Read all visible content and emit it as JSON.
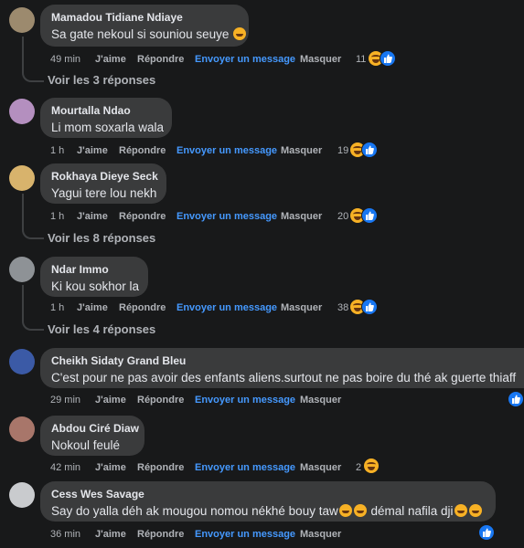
{
  "actions": {
    "like": "J'aime",
    "reply": "Répondre",
    "message": "Envoyer un message",
    "hide": "Masquer"
  },
  "comments": [
    {
      "author": "Mamadou Tidiane Ndiaye",
      "text": "Sa gate nekoul si souniou seuye",
      "time": "49 min",
      "reactions": "11",
      "replies": "Voir les 3 réponses"
    },
    {
      "author": "Mourtalla Ndao",
      "text": "Li mom soxarla wala",
      "time": "1 h",
      "reactions": "19"
    },
    {
      "author": "Rokhaya Dieye Seck",
      "text": "Yagui tere lou nekh",
      "time": "1 h",
      "reactions": "20",
      "replies": "Voir les 8 réponses"
    },
    {
      "author": "Ndar Immo",
      "text": "Ki kou sokhor la",
      "time": "1 h",
      "reactions": "38",
      "replies": "Voir les 4 réponses"
    },
    {
      "author": "Cheikh Sidaty Grand Bleu",
      "text": "C'est pour ne pas avoir des enfants aliens.surtout ne pas boire du thé ak guerte thiaff",
      "time": "29 min"
    },
    {
      "author": "Abdou Ciré Diaw",
      "text": "Nokoul feulé",
      "time": "42 min",
      "reactions": "2"
    },
    {
      "author": "Cess Wes Savage",
      "text_a": "Say do yalla déh ak mougou nomou nékhé bouy taw",
      "text_b": " démal nafila dji",
      "time": "36 min"
    }
  ]
}
